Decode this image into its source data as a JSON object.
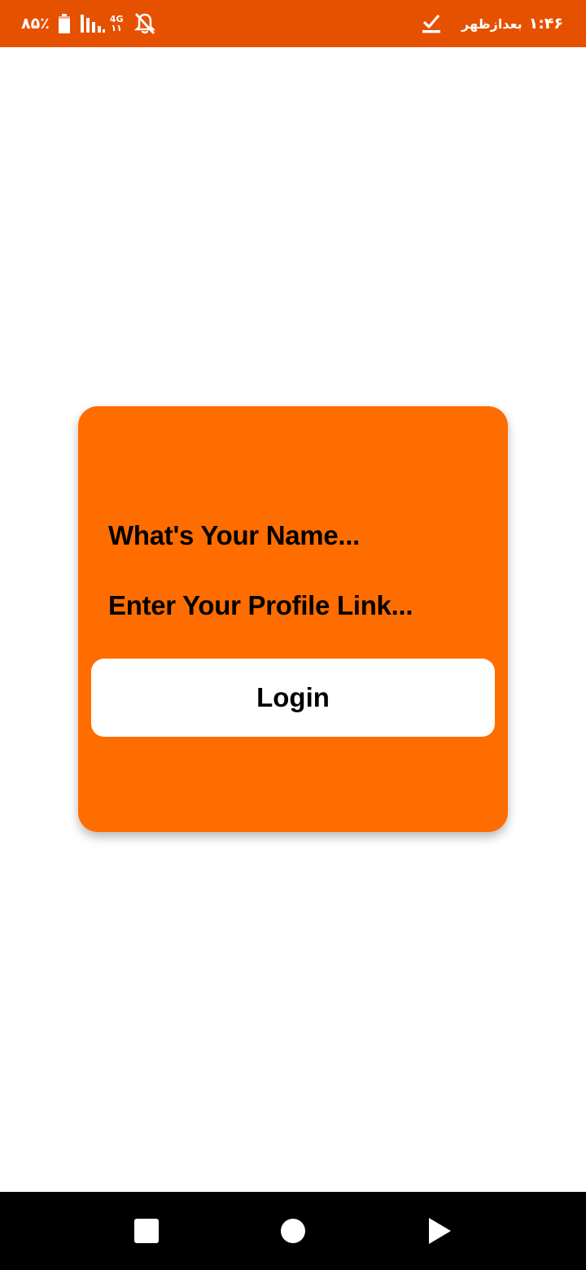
{
  "status_bar": {
    "battery_percent": "۸۵٪",
    "network_type_top": "4G",
    "network_type_bottom": "۱۱",
    "time": "۱:۴۶",
    "period": "بعدازظهر",
    "icons": [
      "battery-icon",
      "signal-icon",
      "bell-off-icon",
      "download-done-icon"
    ],
    "color": "#e65100"
  },
  "login_card": {
    "name_field_text": "What's Your Name...",
    "profile_link_field_text": "Enter Your Profile Link...",
    "login_label": "Login",
    "card_color": "#ff6d00",
    "button_color": "#ffffff"
  },
  "nav_bar": {
    "icons": [
      "recent-apps-icon",
      "home-icon",
      "back-icon"
    ],
    "color": "#000000"
  }
}
